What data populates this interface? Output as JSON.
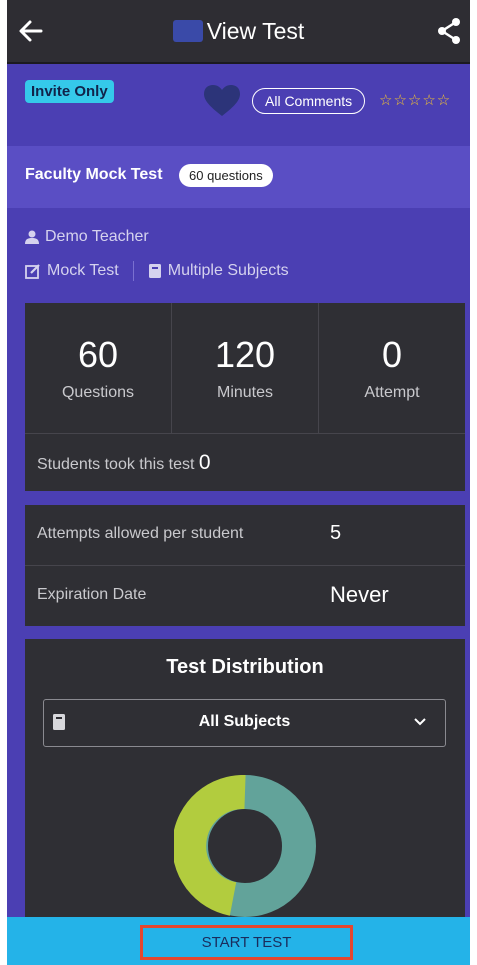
{
  "topbar": {
    "title": "View Test"
  },
  "banner": {
    "badge": "Invite Only",
    "comments_label": "All Comments",
    "stars": "☆☆☆☆☆"
  },
  "test": {
    "name": "Faculty Mock Test",
    "questions_pill": "60 questions",
    "teacher": "Demo Teacher",
    "type": "Mock Test",
    "subjects": "Multiple Subjects"
  },
  "stats": {
    "questions": {
      "value": "60",
      "label": "Questions"
    },
    "minutes": {
      "value": "120",
      "label": "Minutes"
    },
    "attempt": {
      "value": "0",
      "label": "Attempt"
    },
    "students_label": "Students took this test",
    "students_value": "0"
  },
  "details": {
    "attempts_label": "Attempts allowed per student",
    "attempts_value": "5",
    "expiration_label": "Expiration Date",
    "expiration_value": "Never"
  },
  "distribution": {
    "title": "Test Distribution",
    "selected_subject": "All Subjects",
    "colors": {
      "segment_a": "#62a39a",
      "segment_b": "#b2cc3e"
    }
  },
  "footer": {
    "start_label": "START TEST"
  }
}
